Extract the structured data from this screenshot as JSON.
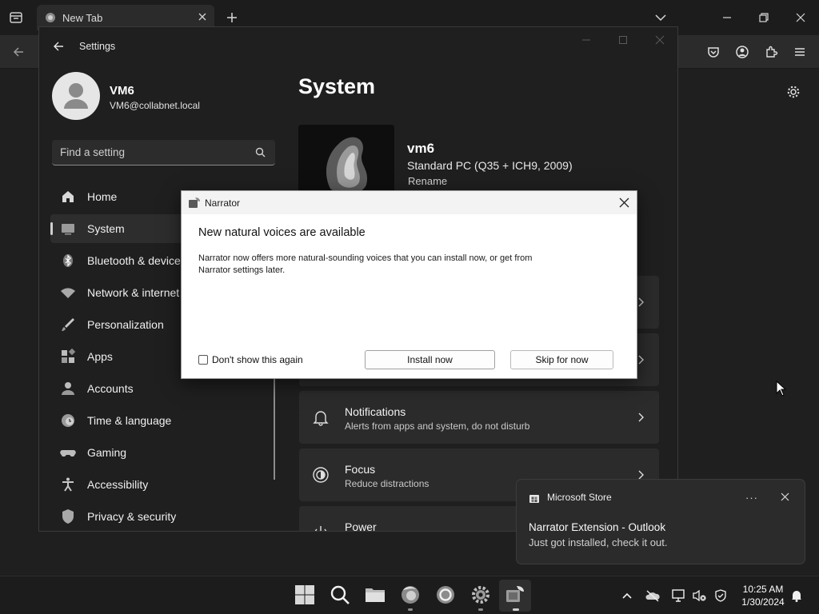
{
  "browser": {
    "tab_title": "New Tab"
  },
  "settings": {
    "window_title": "Settings",
    "profile": {
      "name": "VM6",
      "email": "VM6@collabnet.local"
    },
    "search_placeholder": "Find a setting",
    "nav": [
      {
        "label": "Home",
        "icon": "home-icon"
      },
      {
        "label": "System",
        "icon": "system-icon",
        "selected": true
      },
      {
        "label": "Bluetooth & devices",
        "icon": "bluetooth-icon"
      },
      {
        "label": "Network & internet",
        "icon": "wifi-icon"
      },
      {
        "label": "Personalization",
        "icon": "brush-icon"
      },
      {
        "label": "Apps",
        "icon": "apps-icon"
      },
      {
        "label": "Accounts",
        "icon": "accounts-icon"
      },
      {
        "label": "Time & language",
        "icon": "clock-globe-icon"
      },
      {
        "label": "Gaming",
        "icon": "gamepad-icon"
      },
      {
        "label": "Accessibility",
        "icon": "accessibility-icon"
      },
      {
        "label": "Privacy & security",
        "icon": "shield-icon"
      }
    ],
    "page_title": "System",
    "device": {
      "name": "vm6",
      "model": "Standard PC (Q35 + ICH9, 2009)",
      "rename": "Rename"
    },
    "cards": [
      {
        "title": "Notifications",
        "sub": "Alerts from apps and system, do not disturb",
        "icon": "bell-icon"
      },
      {
        "title": "Focus",
        "sub": "Reduce distractions",
        "icon": "focus-icon"
      },
      {
        "title": "Power",
        "sub": "",
        "icon": "power-icon"
      }
    ]
  },
  "narrator_dialog": {
    "title": "Narrator",
    "heading": "New natural voices are available",
    "body": "Narrator now offers more natural-sounding voices that you can install now, or get from Narrator settings later.",
    "checkbox_label": "Don't show this again",
    "install_label": "Install now",
    "skip_label": "Skip for now"
  },
  "toast": {
    "app": "Microsoft Store",
    "more": "···",
    "title": "Narrator Extension - Outlook",
    "body": "Just got installed, check it out."
  },
  "taskbar": {
    "apps": [
      "start-icon",
      "search-icon",
      "file-explorer-icon",
      "firefox-icon",
      "circle-app-icon",
      "settings-gear-icon",
      "narrator-icon"
    ],
    "time": "10:25 AM",
    "date": "1/30/2024"
  },
  "colors": {
    "page_bg": "#202020",
    "card_bg": "#2b2b2b",
    "dialog_bg": "#ffffff"
  }
}
